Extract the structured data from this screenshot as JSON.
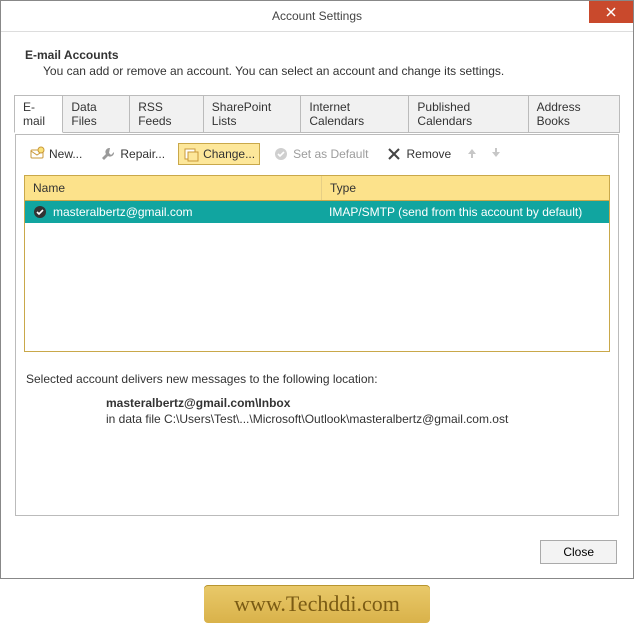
{
  "window": {
    "title": "Account Settings"
  },
  "header": {
    "title": "E-mail Accounts",
    "description": "You can add or remove an account. You can select an account and change its settings."
  },
  "tabs": [
    {
      "label": "E-mail",
      "active": true
    },
    {
      "label": "Data Files"
    },
    {
      "label": "RSS Feeds"
    },
    {
      "label": "SharePoint Lists"
    },
    {
      "label": "Internet Calendars"
    },
    {
      "label": "Published Calendars"
    },
    {
      "label": "Address Books"
    }
  ],
  "toolbar": {
    "new": "New...",
    "repair": "Repair...",
    "change": "Change...",
    "set_default": "Set as Default",
    "remove": "Remove"
  },
  "columns": {
    "name": "Name",
    "type": "Type"
  },
  "accounts": [
    {
      "name": "masteralbertz@gmail.com",
      "type": "IMAP/SMTP (send from this account by default)",
      "default": true
    }
  ],
  "footer": {
    "intro": "Selected account delivers new messages to the following location:",
    "location_bold": "masteralbertz@gmail.com\\Inbox",
    "location_path": "in data file C:\\Users\\Test\\...\\Microsoft\\Outlook\\masteralbertz@gmail.com.ost"
  },
  "buttons": {
    "close": "Close"
  },
  "watermark": "www.Techddi.com"
}
